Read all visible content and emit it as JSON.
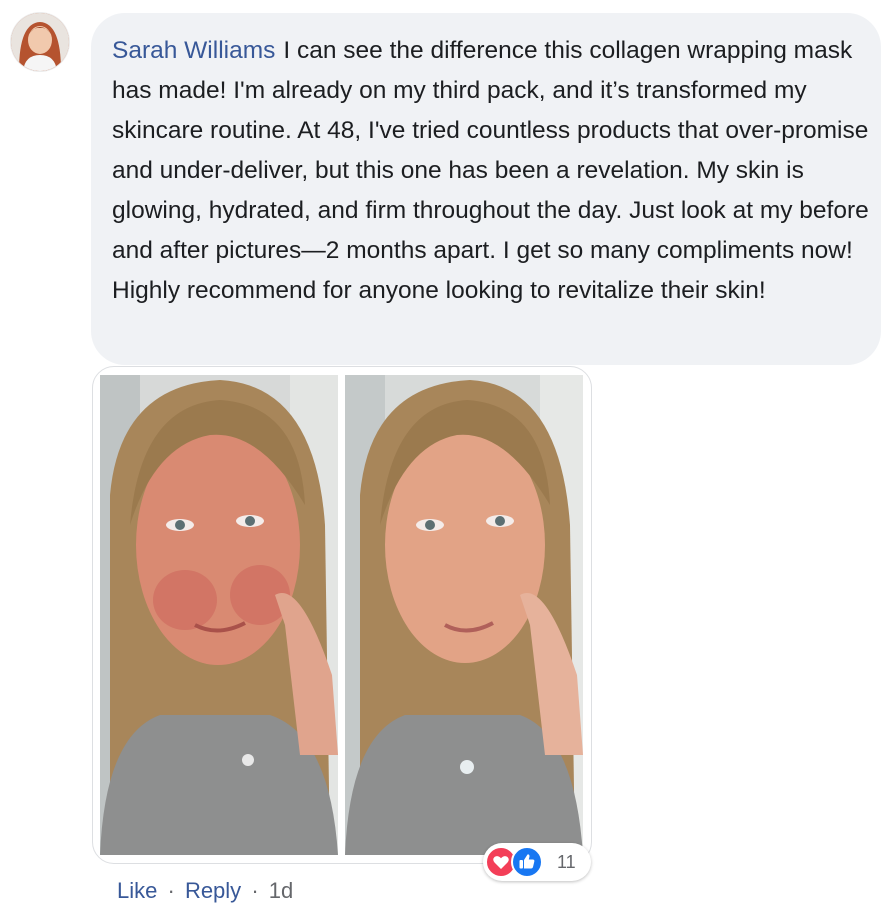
{
  "comment": {
    "author": "Sarah Williams",
    "text": "I can see the difference this collagen wrapping mask has made! I'm already on my third pack, and it’s transformed my skincare routine. At 48, I've tried countless products that over-promise and under-deliver, but this one has been a revelation. My skin is glowing, hydrated, and firm throughout the day. Just look at my before and after pictures—2 months apart. I get so many compliments now! Highly recommend for anyone looking to revitalize their skin!"
  },
  "reactions": {
    "count": "11",
    "icons": [
      "heart-icon",
      "thumbs-up-icon"
    ]
  },
  "actions": {
    "like_label": "Like",
    "separator": "·",
    "reply_label": "Reply",
    "timestamp": "1d"
  },
  "colors": {
    "author_link": "#385898",
    "bubble_bg": "#f0f2f5",
    "love": "#f33e58",
    "like": "#1877f2",
    "meta_text": "#65676b"
  }
}
